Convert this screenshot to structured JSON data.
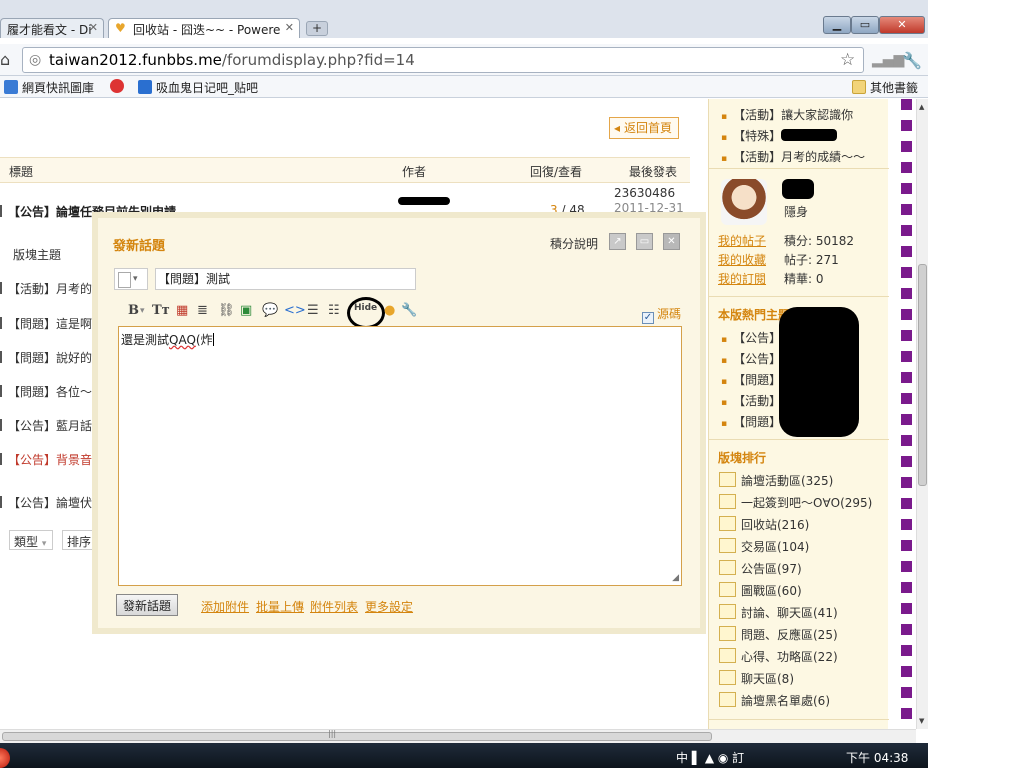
{
  "tabs": [
    {
      "label": "履才能看文 - Di",
      "active": false
    },
    {
      "label": "回收站 - 囧迭~~ - Powere",
      "active": true
    }
  ],
  "address": {
    "host": "taiwan2012.funbbs.me",
    "path": "/forumdisplay.php?fid=14"
  },
  "bookmarks": [
    {
      "label": "網頁快訊圖庫",
      "color": "#3a7bd5"
    },
    {
      "label": "",
      "color": "#d33"
    },
    {
      "label": "吸血鬼日记吧_贴吧",
      "color": "#2a6fd0"
    }
  ],
  "other_bookmarks": "其他書籤",
  "back_home": "返回首頁",
  "list_head": {
    "title": "標題",
    "author": "作者",
    "replies": "回復/查看",
    "last": "最後發表"
  },
  "first_row": {
    "title": "【公告】論壇任務目前先別申請",
    "replies": "3",
    "views": " / 48",
    "last_id": "23630486",
    "last_date": "2011-12-31"
  },
  "section_label": "版塊主題",
  "rows": [
    {
      "text": "【活動】月考的",
      "red": false
    },
    {
      "text": "【問題】這是啊",
      "red": false
    },
    {
      "text": "【問題】說好的",
      "red": false
    },
    {
      "text": "【問題】各位～",
      "red": false
    },
    {
      "text": "【公告】藍月話",
      "red": false
    },
    {
      "text": "【公告】背景音",
      "red": true
    },
    {
      "text": "【公告】論壇伏",
      "red": false
    }
  ],
  "filters": {
    "type": "類型",
    "sort": "排序"
  },
  "sidebar": {
    "top_items": [
      "【活動】讓大家認識你",
      "【特殊】",
      "【活動】月考的成績～～"
    ],
    "user_status": "隱身",
    "my_posts": "我的帖子",
    "my_favs": "我的收藏",
    "my_subs": "我的訂閱",
    "points": "積分: 50182",
    "posts": "帖子: 271",
    "essence": "精華: 0",
    "hot_title": "本版熱門主題",
    "hot_items": [
      "【公告】",
      "【公告】",
      "【問題】",
      "【活動】",
      "【問題】"
    ],
    "rank_title": "版塊排行",
    "boards": [
      "論壇活動區(325)",
      "一起簽到吧～O∀O(295)",
      "回收站(216)",
      "交易區(104)",
      "公告區(97)",
      "圖戰區(60)",
      "討論、聊天區(41)",
      "問題、反應區(25)",
      "心得、功略區(22)",
      "聊天區(8)",
      "論壇黑名單處(6)"
    ]
  },
  "modal": {
    "title": "發新話題",
    "credit_link": "積分說明",
    "subject": "【問題】測試",
    "source_label": "源碼",
    "hide_label": "Hide",
    "body_prefix": "還是測試",
    "body_squiggle": "QAQ",
    "body_suffix": "(炸",
    "submit": "發新話題",
    "links": [
      "添加附件",
      "批量上傳",
      "附件列表",
      "更多設定"
    ]
  },
  "taskbar": {
    "tray": "中 ▌ ▲ ◉ 訂",
    "clock": "下午 04:38"
  },
  "colors": {
    "accent": "#d4850f",
    "sidebar_bg": "#fdf8e3",
    "purple": "#7a1a8c"
  }
}
